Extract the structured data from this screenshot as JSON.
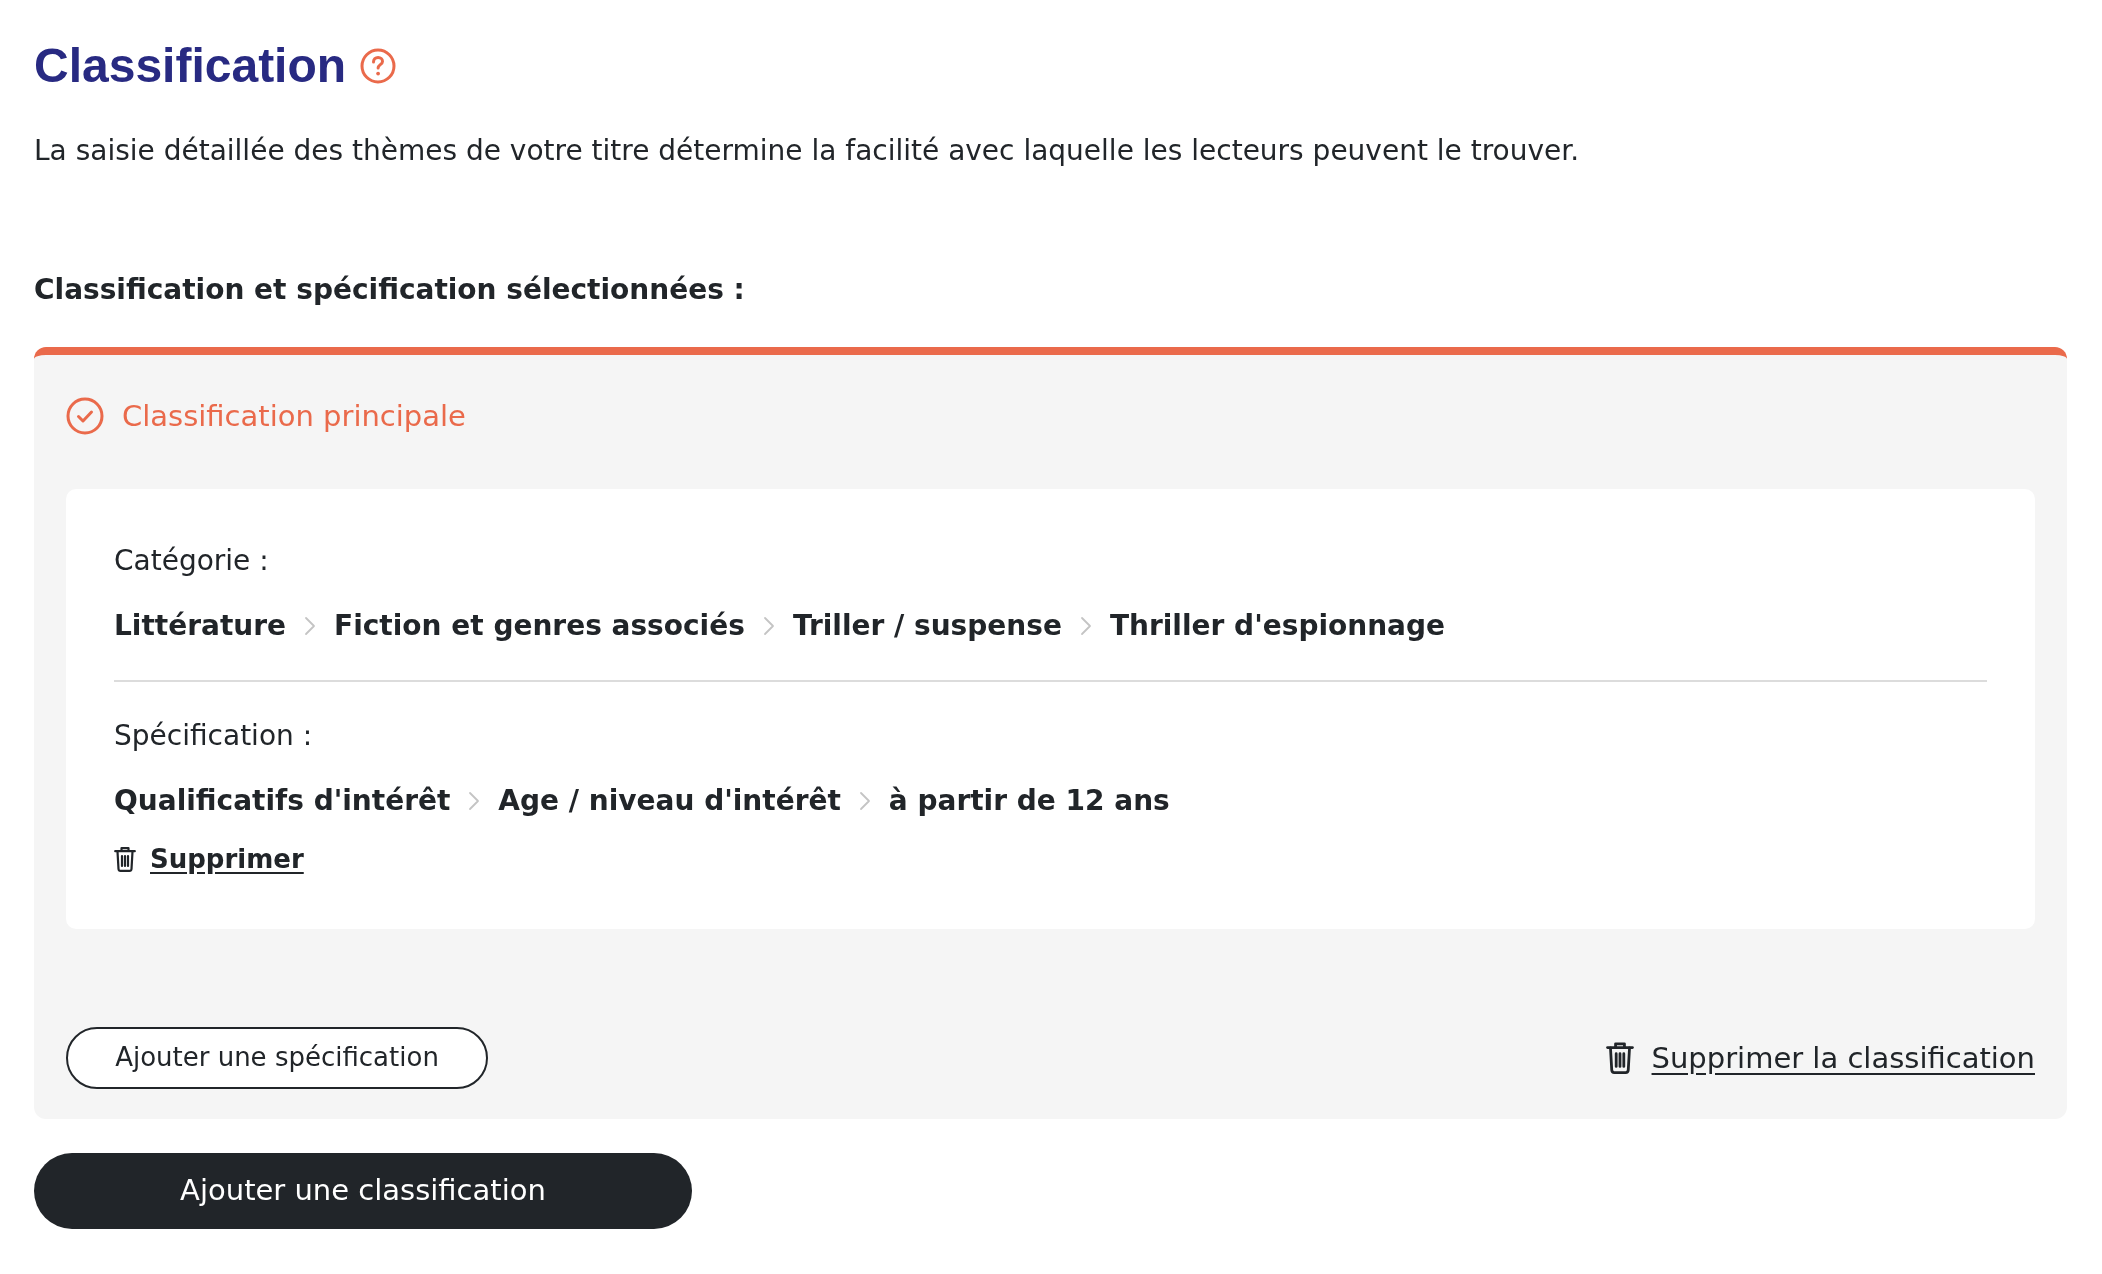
{
  "header": {
    "title": "Classification",
    "description": "La saisie détaillée des thèmes de votre titre détermine la facilité avec laquelle les lecteurs peuvent le trouver."
  },
  "section_title": "Classification et spécification sélectionnées :",
  "classifications": [
    {
      "label": "Classification principale",
      "category": {
        "label": "Catégorie :",
        "path": [
          "Littérature",
          "Fiction et genres associés",
          "Triller / suspense",
          "Thriller d'espionnage"
        ]
      },
      "specifications": [
        {
          "label": "Spécification :",
          "path": [
            "Qualificatifs d'intérêt",
            "Age / niveau d'intérêt",
            "à partir de 12 ans"
          ],
          "delete_link": "Supprimer"
        }
      ],
      "add_specification_button": "Ajouter une spécification",
      "delete_classification_link": "Supprimer la classification"
    }
  ],
  "add_classification_button": "Ajouter une classification"
}
